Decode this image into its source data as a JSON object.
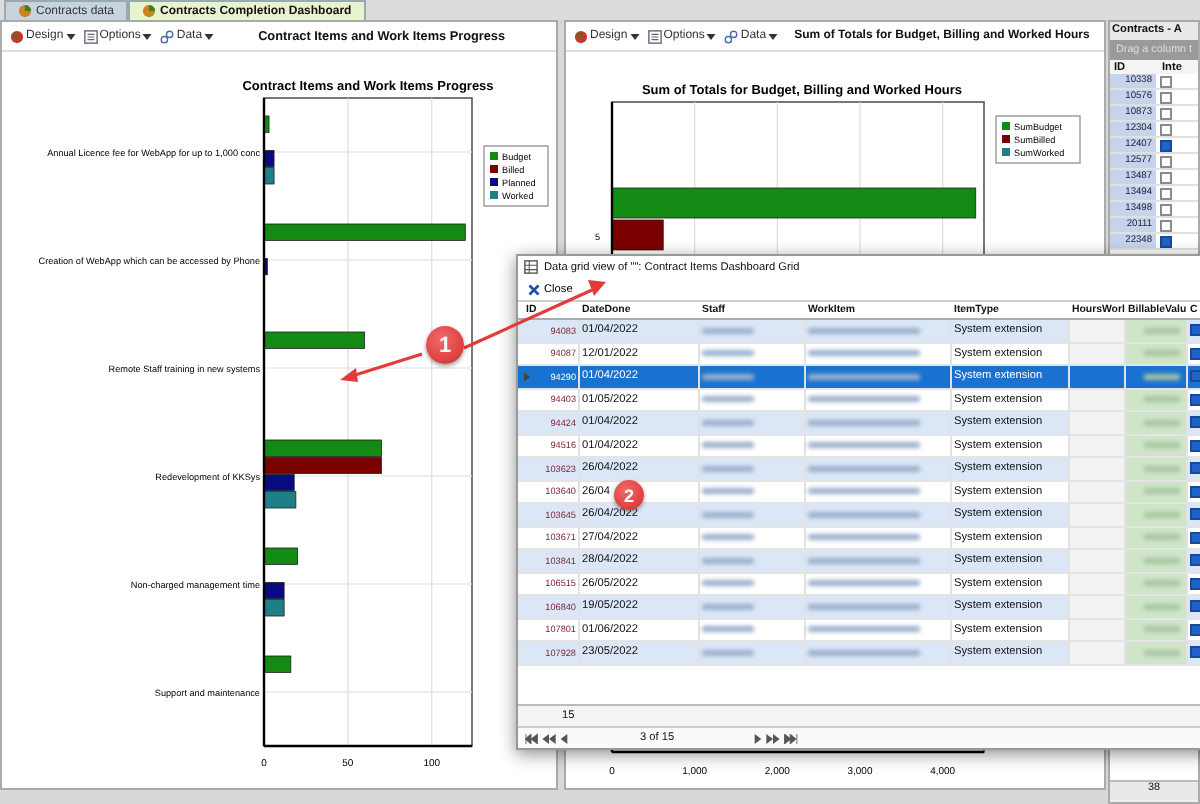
{
  "tabs": [
    {
      "label": "Contracts data",
      "selected": false
    },
    {
      "label": "Contracts Completion Dashboard",
      "selected": true
    }
  ],
  "panels": [
    {
      "toolbar": [
        "Design",
        "Options",
        "Data"
      ],
      "title": "Contract Items and Work Items Progress",
      "chart_data": {
        "type": "bar",
        "orientation": "horizontal",
        "title": "Contract Items and Work Items Progress",
        "categories": [
          "Annual Licence fee for WebApp for up to 1,000 conc",
          "Creation of WebApp which can be accessed by Phone",
          "Remote Staff training in new systems",
          "Redevelopment of KKSys",
          "Non-charged management time",
          "Support and maintenance"
        ],
        "series": [
          {
            "name": "Budget",
            "color": "#138a13",
            "values": [
              3,
              120,
              60,
              70,
              20,
              16
            ]
          },
          {
            "name": "Billed",
            "color": "#7a0000",
            "values": [
              0,
              0,
              0,
              70,
              0,
              0
            ]
          },
          {
            "name": "Planned",
            "color": "#0b0b80",
            "values": [
              6,
              2,
              0,
              18,
              12,
              0
            ]
          },
          {
            "name": "Worked",
            "color": "#1e7f86",
            "values": [
              6,
              0,
              0,
              19,
              12,
              0
            ]
          }
        ],
        "grid": true,
        "legend": true,
        "xlim": [
          0,
          124
        ],
        "xticks": [
          0,
          50,
          100
        ]
      }
    },
    {
      "toolbar": [
        "Design",
        "Options",
        "Data"
      ],
      "title": "Sum of Totals for Budget, Billing and Worked Hours",
      "chart_data": {
        "type": "bar",
        "orientation": "horizontal",
        "title": "Sum of Totals for Budget, Billing and Worked Hours",
        "categories": [
          "5"
        ],
        "series": [
          {
            "name": "SumBudget",
            "color": "#138a13",
            "values": [
              4400
            ]
          },
          {
            "name": "SumBilled",
            "color": "#7a0000",
            "values": [
              620
            ]
          },
          {
            "name": "SumWorked",
            "color": "#1e7f86",
            "values": [
              null
            ]
          }
        ],
        "grid": true,
        "legend": true,
        "xlim": [
          0,
          4500
        ],
        "xticks": [
          {
            "value": 0,
            "label": "0"
          },
          {
            "value": 1000,
            "label": "1,000"
          },
          {
            "value": 2000,
            "label": "2,000"
          },
          {
            "value": 3000,
            "label": "3,000"
          },
          {
            "value": 4000,
            "label": "4,000"
          }
        ]
      }
    }
  ],
  "contracts_grid": {
    "title": "Contracts - A",
    "group_hint": "Drag a column t",
    "columns": [
      "ID",
      "Inte"
    ],
    "rows": [
      {
        "id": "10338",
        "checked": false
      },
      {
        "id": "10576",
        "checked": false
      },
      {
        "id": "10873",
        "checked": false
      },
      {
        "id": "12304",
        "checked": false
      },
      {
        "id": "12407",
        "checked": true
      },
      {
        "id": "12577",
        "checked": false
      },
      {
        "id": "13487",
        "checked": false
      },
      {
        "id": "13494",
        "checked": false
      },
      {
        "id": "13498",
        "checked": false
      },
      {
        "id": "20111",
        "checked": false
      },
      {
        "id": "22348",
        "checked": true
      }
    ],
    "footer": "38"
  },
  "dialog": {
    "title": "Data grid view of \"\": Contract Items Dashboard Grid",
    "close": "Close",
    "columns": [
      "ID",
      "DateDone",
      "Staff",
      "WorkItem",
      "ItemType",
      "HoursWorl",
      "BillableValu",
      "C"
    ],
    "rows": [
      {
        "id": "94083",
        "date": "01/04/2022",
        "type": "System extension",
        "checked": true,
        "selected": false
      },
      {
        "id": "94087",
        "date": "12/01/2022",
        "type": "System extension",
        "checked": true,
        "selected": false
      },
      {
        "id": "94290",
        "date": "01/04/2022",
        "type": "System extension",
        "checked": true,
        "selected": true
      },
      {
        "id": "94403",
        "date": "01/05/2022",
        "type": "System extension",
        "checked": true,
        "selected": false
      },
      {
        "id": "94424",
        "date": "01/04/2022",
        "type": "System extension",
        "checked": true,
        "selected": false
      },
      {
        "id": "94516",
        "date": "01/04/2022",
        "type": "System extension",
        "checked": true,
        "selected": false
      },
      {
        "id": "103623",
        "date": "26/04/2022",
        "type": "System extension",
        "checked": true,
        "selected": false
      },
      {
        "id": "103640",
        "date": "26/04",
        "type": "System extension",
        "checked": true,
        "selected": false
      },
      {
        "id": "103645",
        "date": "26/04/2022",
        "type": "System extension",
        "checked": true,
        "selected": false
      },
      {
        "id": "103671",
        "date": "27/04/2022",
        "type": "System extension",
        "checked": true,
        "selected": false
      },
      {
        "id": "103841",
        "date": "28/04/2022",
        "type": "System extension",
        "checked": true,
        "selected": false
      },
      {
        "id": "106515",
        "date": "26/05/2022",
        "type": "System extension",
        "checked": true,
        "selected": false
      },
      {
        "id": "106840",
        "date": "19/05/2022",
        "type": "System extension",
        "checked": true,
        "selected": false
      },
      {
        "id": "107801",
        "date": "01/06/2022",
        "type": "System extension",
        "checked": true,
        "selected": false
      },
      {
        "id": "107928",
        "date": "23/05/2022",
        "type": "System extension",
        "checked": true,
        "selected": false
      }
    ],
    "count": "15",
    "pager": "3 of 15"
  },
  "annotations": [
    {
      "label": "1"
    },
    {
      "label": "2"
    }
  ]
}
